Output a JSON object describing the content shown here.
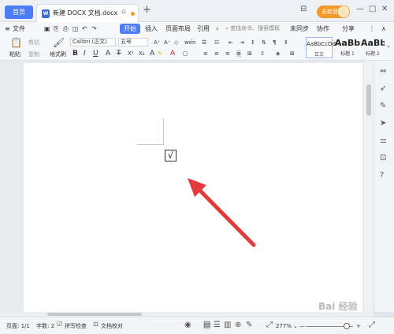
{
  "titlebar": {
    "home_tab": "首页",
    "doc_tab": "新建 DOCX 文档.docx",
    "doc_icon": "W",
    "login": "去新登录"
  },
  "menubar": {
    "file": "文件",
    "items": [
      "开始",
      "插入",
      "页面布局",
      "引用"
    ],
    "search_placeholder": "查找命令、搜索模板",
    "right_items": [
      "未同步",
      "协作",
      "分享"
    ]
  },
  "ribbon": {
    "paste": "粘贴",
    "cut": "剪切",
    "copy": "复制",
    "format_painter": "格式刷",
    "font_name": "Calibri (正文)",
    "font_size": "五号",
    "styles": [
      {
        "sample": "AaBbCcDd",
        "name": "正文"
      },
      {
        "sample": "AaBb",
        "name": "标题 1"
      },
      {
        "sample": "AaBb",
        "name": "标题 2"
      }
    ]
  },
  "document": {
    "checkbox_mark": "√"
  },
  "statusbar": {
    "page": "页面: 1/1",
    "words": "字数: 2",
    "spellcheck": "拼写检查",
    "proofread": "文档校对",
    "zoom": "277%"
  },
  "watermark": "Bai 经验",
  "colors": {
    "accent": "#4a7cf7",
    "login": "#f39a2b",
    "arrow": "#e23b3b"
  }
}
